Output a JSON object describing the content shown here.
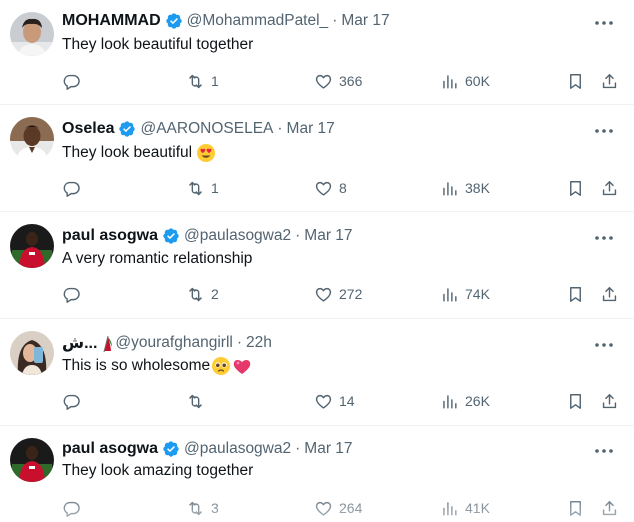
{
  "tweets": [
    {
      "name": "MOHAMMAD",
      "handle": "@MohammadPatel_",
      "separator": "·",
      "time": "Mar 17",
      "text": "They look beautiful together",
      "emojis": [],
      "avatar_icon": "man-portrait-avatar",
      "replies": "",
      "retweets": "1",
      "likes": "366",
      "views": "60K"
    },
    {
      "name": "Oselea",
      "handle": "@AARONOSELEA",
      "separator": "·",
      "time": "Mar 17",
      "text": "They look beautiful",
      "emojis": [
        "heart-eyes-emoji"
      ],
      "avatar_icon": "man-white-shirt-avatar",
      "replies": "",
      "retweets": "1",
      "likes": "8",
      "views": "38K"
    },
    {
      "name": "paul asogwa",
      "handle": "@paulasogwa2",
      "separator": "·",
      "time": "Mar 17",
      "text": "A very romantic relationship",
      "emojis": [],
      "avatar_icon": "red-jersey-player-avatar",
      "replies": "",
      "retweets": "2",
      "likes": "272",
      "views": "74K"
    },
    {
      "name": "ش...",
      "handle": "@yourafghangirll",
      "separator": "·",
      "time": "22h",
      "text": "This is so wholesome",
      "emojis": [
        "pleading-face-emoji",
        "pink-heart-emoji"
      ],
      "avatar_icon": "woman-selfie-avatar",
      "name_flag_icon": "afghan-flag-emoji",
      "replies": "",
      "retweets": "",
      "likes": "14",
      "views": "26K"
    },
    {
      "name": "paul asogwa",
      "handle": "@paulasogwa2",
      "separator": "·",
      "time": "Mar 17",
      "text": "They look amazing together",
      "emojis": [],
      "avatar_icon": "red-jersey-player-avatar",
      "replies": "",
      "retweets": "3",
      "likes": "264",
      "views": "41K"
    }
  ],
  "colors": {
    "verified_blue": "#1d9bf0",
    "secondary_text": "#536471",
    "primary_text": "#0f1419",
    "divider": "#eff3f4"
  }
}
